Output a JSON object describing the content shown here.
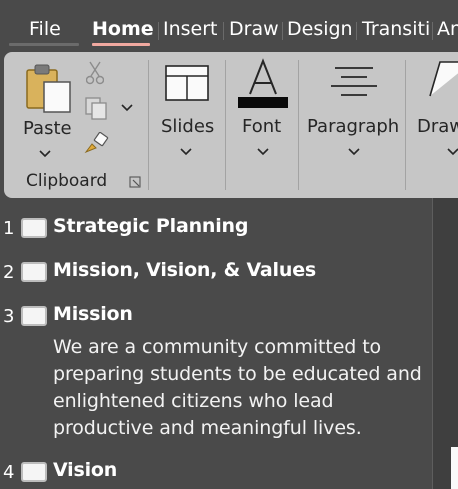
{
  "tabs": [
    {
      "label": "File"
    },
    {
      "label": "Home"
    },
    {
      "label": "Insert"
    },
    {
      "label": "Draw"
    },
    {
      "label": "Design"
    },
    {
      "label": "Transiti"
    },
    {
      "label": "An"
    }
  ],
  "ribbon": {
    "paste_label": "Paste",
    "clipboard_label": "Clipboard",
    "slides_label": "Slides",
    "font_label": "Font",
    "paragraph_label": "Paragraph",
    "draw_label": "Draw"
  },
  "outline": {
    "slides": [
      {
        "number": "1",
        "title": "Strategic Planning"
      },
      {
        "number": "2",
        "title": "Mission, Vision, & Values"
      },
      {
        "number": "3",
        "title": "Mission",
        "body": [
          "We are a community committed to",
          "preparing students to be educated and",
          "enlightened citizens who lead",
          "productive and meaningful lives."
        ]
      },
      {
        "number": "4",
        "title": "Vision"
      }
    ]
  },
  "colors": {
    "background": "#4a4a4a",
    "ribbon": "#c6c6c6",
    "active_tab_underline": "#f1a9a0"
  }
}
